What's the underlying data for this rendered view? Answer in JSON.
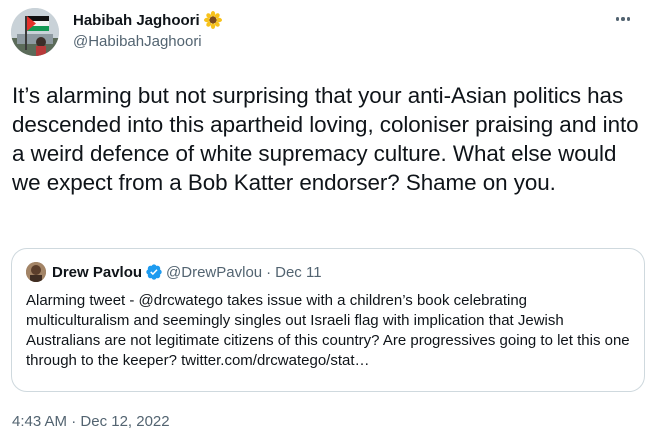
{
  "author": {
    "display_name": "Habibah Jaghoori",
    "handle": "@HabibahJaghoori",
    "name_emoji": "sunflower-icon"
  },
  "more_icon": "more-horizontal-icon",
  "tweet": {
    "text": "It’s alarming but not surprising that your anti-Asian politics has descended into this apartheid loving, coloniser praising and into a weird defence of white supremacy culture. What else would we expect from a Bob Katter endorser? Shame on you."
  },
  "quoted_tweet": {
    "display_name": "Drew Pavlou",
    "verified_icon": "verified-badge-icon",
    "handle": "@DrewPavlou",
    "separator": "·",
    "date": "Dec 11",
    "text": "Alarming tweet - @drcwatego takes issue with a children’s book celebrating multiculturalism and seemingly singles out Israeli flag with implication that Jewish Australians are not legitimate citizens of this country? Are progressives going to let this one through to the keeper? twitter.com/drcwatego/stat…"
  },
  "timestamp": {
    "time": "4:43 AM",
    "separator": "·",
    "date": "Dec 12, 2022"
  },
  "colors": {
    "text_primary": "#0f1419",
    "text_secondary": "#536471",
    "border": "#cfd9de",
    "verified_blue": "#1d9bf0"
  }
}
